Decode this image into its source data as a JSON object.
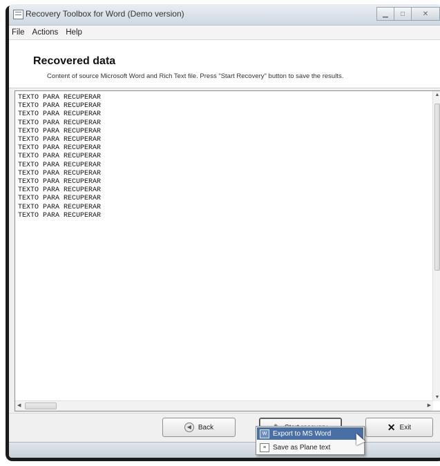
{
  "window": {
    "title": "Recovery Toolbox for Word (Demo version)"
  },
  "menu": {
    "items": [
      "File",
      "Actions",
      "Help"
    ]
  },
  "header": {
    "title": "Recovered data",
    "subtitle": "Content of source Microsoft Word and Rich Text file. Press \"Start Recovery\" button to save the results."
  },
  "editor": {
    "lines": [
      "TEXTO PARA RECUPERAR",
      "TEXTO PARA RECUPERAR",
      "TEXTO PARA RECUPERAR",
      "TEXTO PARA RECUPERAR",
      "TEXTO PARA RECUPERAR",
      "TEXTO PARA RECUPERAR",
      "TEXTO PARA RECUPERAR",
      "TEXTO PARA RECUPERAR",
      "TEXTO PARA RECUPERAR",
      "TEXTO PARA RECUPERAR",
      "TEXTO PARA RECUPERAR",
      "TEXTO PARA RECUPERAR",
      "TEXTO PARA RECUPERAR",
      "TEXTO PARA RECUPERAR",
      "TEXTO PARA RECUPERAR"
    ]
  },
  "buttons": {
    "back": "Back",
    "start": "Start recovery",
    "exit": "Exit"
  },
  "popup": {
    "items": [
      "Export to MS Word",
      "Save as Plane text"
    ]
  },
  "icons": {
    "app": "app-icon",
    "back": "back-icon",
    "start": "pen-icon",
    "exit": "x-icon",
    "export": "word-doc-icon",
    "save_text": "text-doc-icon"
  },
  "colors": {
    "menu_highlight": "#4a6fa5",
    "titlebar": "#cfd8e1"
  }
}
